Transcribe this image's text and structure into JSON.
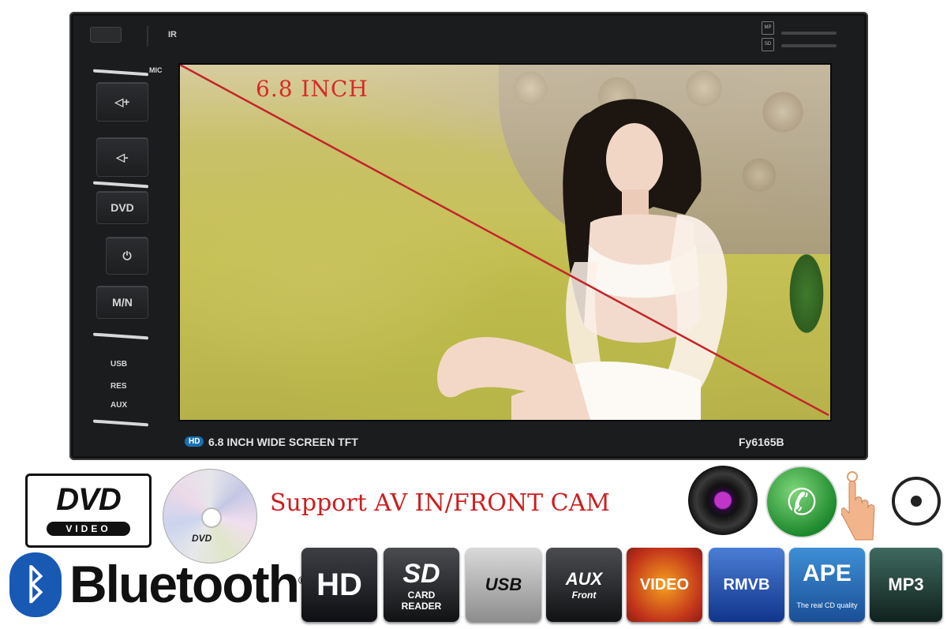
{
  "unit": {
    "ir_label": "IR",
    "mic_label": "MIC",
    "card_icons": [
      "MP",
      "SD"
    ],
    "buttons": {
      "vol_up": "◁+",
      "vol_down": "◁-",
      "dvd": "DVD",
      "power_mute": "⏻",
      "mode": "M/N"
    },
    "side_labels": [
      "USB",
      "RES",
      "AUX"
    ],
    "screen_overlay_label": "6.8 INCH",
    "hd_tag": "HD",
    "model_desc": "6.8 INCH WIDE SCREEN TFT",
    "model_no": "Fy6165B"
  },
  "features": {
    "dvd_logo": {
      "main": "DVD",
      "sub": "VIDEO"
    },
    "disc_label": "DVD",
    "support_text": "Support AV IN/FRONT CAM",
    "bluetooth_symbol": "ᛒ",
    "bluetooth_text": "Bluetooth",
    "bluetooth_mark": "®",
    "icons": [
      "camera-lens-icon",
      "phone-call-icon",
      "touch-screen-icon",
      "steering-wheel-icon"
    ],
    "badges": {
      "hd": "HD",
      "sd_big": "SD",
      "sd_line1": "CARD",
      "sd_line2": "READER",
      "usb": "USB",
      "aux_main": "AUX",
      "aux_sub": "Front",
      "video": "VIDEO",
      "rmvb": "RMVB",
      "ape": "APE",
      "ape_sub": "The real CD quality",
      "mp3": "MP3"
    }
  },
  "colors": {
    "overlay_red": "#d62a2a",
    "support_red": "#cc1f1f",
    "bluetooth_blue": "#1859b4",
    "hd_tag_blue": "#1b6fb3"
  }
}
